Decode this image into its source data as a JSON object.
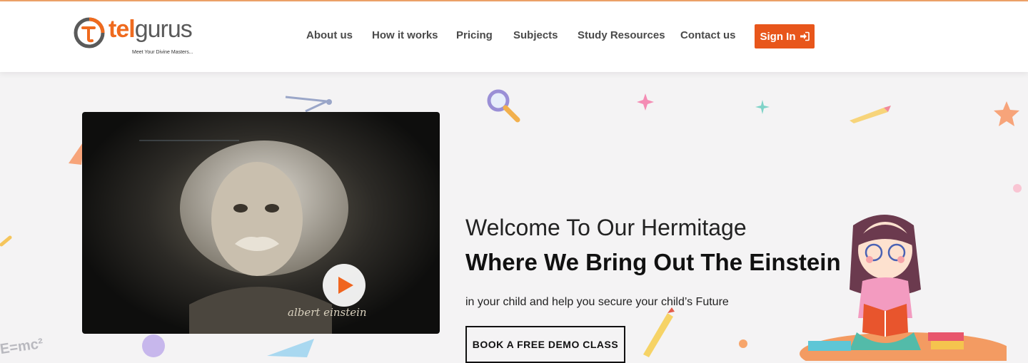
{
  "brand": {
    "name_part1": "tel",
    "name_part2": "gurus",
    "tagline": "Meet Your Divine Masters...",
    "colors": {
      "orange": "#ef6a1e",
      "grey": "#5a5a5a"
    }
  },
  "nav": {
    "items": [
      {
        "label": "About us"
      },
      {
        "label": "How it works"
      },
      {
        "label": "Pricing"
      },
      {
        "label": "Subjects"
      },
      {
        "label": "Study Resources"
      },
      {
        "label": "Contact us"
      }
    ],
    "signin_label": "Sign In",
    "signin_icon": "sign-in-icon"
  },
  "video": {
    "caption": "albert einstein",
    "play_icon": "play-icon"
  },
  "hero": {
    "subtitle": "Welcome To Our Hermitage",
    "title": "Where We Bring Out The Einstein",
    "description": "in your child and help you secure your child’s Future",
    "cta_label": "BOOK A FREE DEMO CLASS"
  },
  "decorations": {
    "formula": "E=mc²"
  }
}
